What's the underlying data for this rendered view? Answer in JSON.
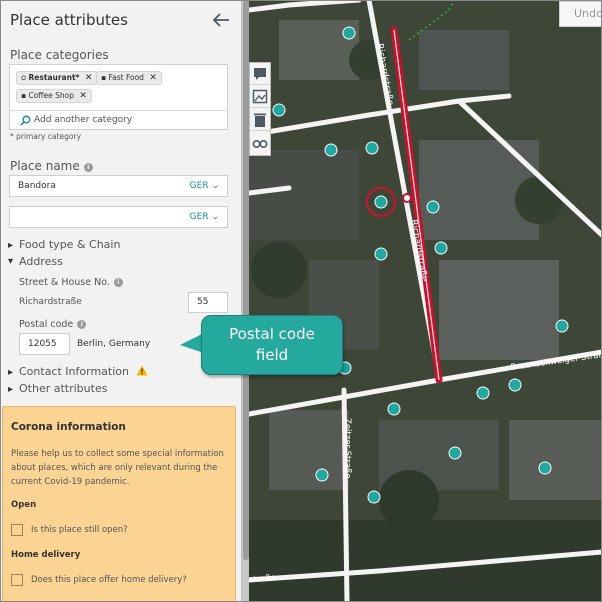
{
  "panel": {
    "title": "Place attributes",
    "categories_label": "Place categories",
    "categories": [
      {
        "label": "Restaurant*",
        "primary": true,
        "icon": "fork-knife-icon"
      },
      {
        "label": "Fast Food",
        "primary": false,
        "icon": "fast-food-icon"
      },
      {
        "label": "Coffee Shop",
        "primary": false,
        "icon": "coffee-icon"
      }
    ],
    "add_category_placeholder": "Add another category",
    "primary_note": "* primary category",
    "place_name_label": "Place name",
    "name_fields": [
      {
        "value": "Bandora",
        "lang": "GER"
      },
      {
        "value": "",
        "lang": "GER"
      }
    ],
    "food_type_label": "Food type & Chain",
    "address_label": "Address",
    "street_label": "Street & House No.",
    "street_value": "Richardstraße",
    "house_no": "55",
    "postal_label": "Postal code",
    "postal_value": "12055",
    "city_value": "Berlin, Germany",
    "contact_label": "Contact Information",
    "other_label": "Other attributes"
  },
  "corona": {
    "title": "Corona information",
    "text": "Please help us to collect some special information about places, which are only relevant during the current Covid-19 pandemic.",
    "open_heading": "Open",
    "open_question": "Is this place still open?",
    "delivery_heading": "Home delivery",
    "delivery_question": "Does this place offer home delivery?"
  },
  "map": {
    "undo_label": "Undo",
    "streets": {
      "richardstrasse_top": "Richardstraße",
      "richardstrasse_mid": "Richardstraße",
      "braunschweiger": "Braunschweiger Straße",
      "zeitzer": "Zeitzer Straße",
      "bottom_fragment": "straße"
    }
  },
  "callout": {
    "line1": "Postal code",
    "line2": "field"
  },
  "colors": {
    "accent": "#1f8f8a",
    "callout": "#25a89e",
    "selected_road": "#c0152f",
    "corona_bg": "#fbd493",
    "poi": "#20a7a0"
  }
}
